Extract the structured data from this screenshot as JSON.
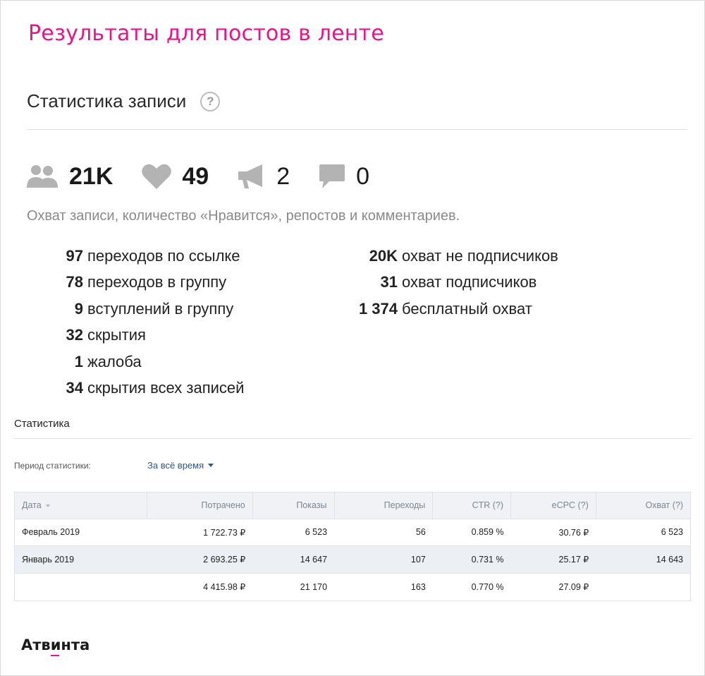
{
  "headline": "Результаты для постов в ленте",
  "post_stats": {
    "title": "Статистика записи",
    "help": "?",
    "metrics": [
      {
        "icon": "people-icon",
        "value": "21K"
      },
      {
        "icon": "heart-icon",
        "value": "49"
      },
      {
        "icon": "megaphone-icon",
        "value": "2"
      },
      {
        "icon": "comment-icon",
        "value": "0"
      }
    ],
    "caption": "Охват записи, количество «Нравится», репостов и комментариев.",
    "left": [
      {
        "num": "97",
        "label": "переходов по ссылке"
      },
      {
        "num": "78",
        "label": "переходов в группу"
      },
      {
        "num": "9",
        "label": "вступлений в группу"
      },
      {
        "num": "32",
        "label": "скрытия"
      },
      {
        "num": "1",
        "label": "жалоба"
      },
      {
        "num": "34",
        "label": "скрытия всех записей"
      }
    ],
    "right": [
      {
        "num": "20K",
        "label": "охват не подписчиков"
      },
      {
        "num": "31",
        "label": "охват подписчиков"
      },
      {
        "num": "1 374",
        "label": "бесплатный охват"
      }
    ]
  },
  "stats": {
    "title": "Статистика",
    "period_label": "Период статистики:",
    "period_value": "За всё время",
    "columns": [
      "Дата",
      "Потрачено",
      "Показы",
      "Переходы",
      "CTR (?)",
      "eCPC (?)",
      "Охват (?)"
    ],
    "rows": [
      [
        "Февраль 2019",
        "1 722.73 ₽",
        "6 523",
        "56",
        "0.859 %",
        "30.76 ₽",
        "6 523"
      ],
      [
        "Январь 2019",
        "2 693.25 ₽",
        "14 647",
        "107",
        "0.731 %",
        "25.17 ₽",
        "14 643"
      ],
      [
        "",
        "4 415.98 ₽",
        "21 170",
        "163",
        "0.770 %",
        "27.09 ₽",
        ""
      ]
    ]
  },
  "brand": "Атвинта",
  "colors": {
    "accent": "#e5168a",
    "link": "#2a5885",
    "icon_gray": "#b3b3b3"
  }
}
